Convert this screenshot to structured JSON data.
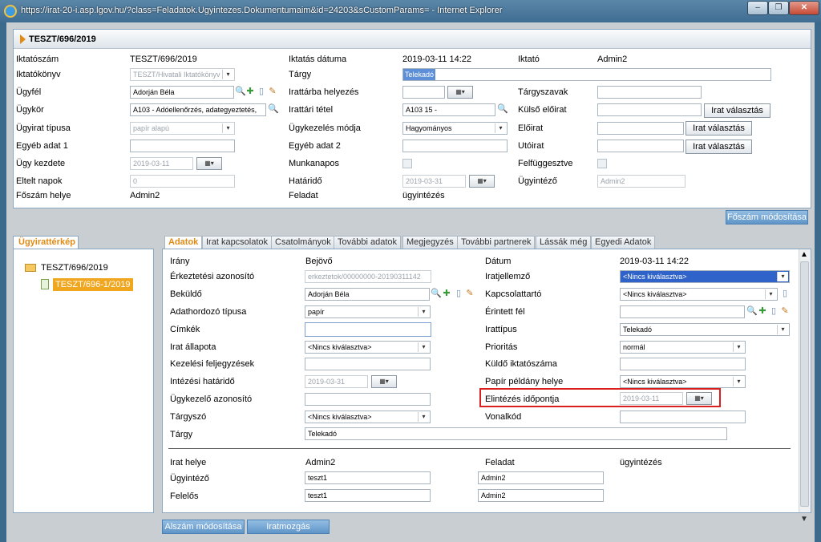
{
  "window": {
    "title": "https://irat-20-i.asp.lgov.hu/?class=Feladatok.Ugyintezes.Dokumentumaim&id=24203&sCustomParams= - Internet Explorer",
    "min": "–",
    "max": "❐",
    "close": "✕"
  },
  "head": {
    "title": "TESZT/696/2019",
    "iktatoszam_l": "Iktatószám",
    "iktatoszam_v": "TESZT/696/2019",
    "iktatokonyv_l": "Iktatókönyv",
    "iktatokonyv_v": "TESZT/Hivatali Iktatókönyv",
    "ugyfel_l": "Ügyfél",
    "ugyfel_v": "Adorján Béla",
    "ugykor_l": "Ügykör",
    "ugykor_v": "A103 - Adóellenőrzés, adategyeztetés,",
    "ugyirat_tipusa_l": "Ügyirat típusa",
    "ugyirat_tipusa_v": "papír alapú",
    "egyeb1_l": "Egyéb adat 1",
    "ugy_kezdete_l": "Ügy kezdete",
    "ugy_kezdete_v": "2019-03-11",
    "eltelt_l": "Eltelt napok",
    "eltelt_v": "0",
    "foszam_helye_l": "Főszám helye",
    "foszam_helye_v": "Admin2",
    "iktatas_datuma_l": "Iktatás dátuma",
    "iktatas_datuma_v": "2019-03-11 14:22",
    "targy_l": "Tárgy",
    "targy_v": "Telekadó",
    "irattarba_l": "Irattárba helyezés",
    "irattari_tetel_l": "Irattári tétel",
    "irattari_tetel_v": "A103 15 -",
    "ugykezeles_l": "Ügykezelés módja",
    "ugykezeles_v": "Hagyományos",
    "egyeb2_l": "Egyéb adat 2",
    "munkanapos_l": "Munkanapos",
    "hatarido_l": "Határidő",
    "hatarido_v": "2019-03-31",
    "feladat_l": "Feladat",
    "feladat_v": "ügyintézés",
    "iktato_l": "Iktató",
    "iktato_v": "Admin2",
    "targyszavak_l": "Tárgyszavak",
    "kulso_eloirat_l": "Külső előirat",
    "eloirat_l": "Előirat",
    "utoirat_l": "Utóirat",
    "felfuggesztve_l": "Felfüggesztve",
    "ugyintezo_l": "Ügyintéző",
    "ugyintezo_v": "Admin2",
    "irat_valasztas": "Irat választás",
    "foszam_modositasa": "Főszám módosítása"
  },
  "left": {
    "tab": "Ügyirattérkép",
    "folder": "TESZT/696/2019",
    "doc": "TESZT/696-1/2019"
  },
  "tabs": [
    "Adatok",
    "Irat kapcsolatok",
    "Csatolmányok",
    "További adatok",
    "Megjegyzés",
    "További partnerek",
    "Lássák még",
    "Egyedi Adatok"
  ],
  "form": {
    "irany_l": "Irány",
    "irany_v": "Bejövő",
    "erkeztetesi_l": "Érkeztetési azonosító",
    "erkeztetesi_v": "erkeztetok/00000000-20190311142",
    "bekuldo_l": "Beküldő",
    "bekuldo_v": "Adorján Béla",
    "adathordozo_l": "Adathordozó típusa",
    "adathordozo_v": "papír",
    "cimkek_l": "Címkék",
    "irat_allapota_l": "Irat állapota",
    "irat_allapota_v": "<Nincs kiválasztva>",
    "kezelesi_l": "Kezelési feljegyzések",
    "intezesi_l": "Intézési határidő",
    "intezesi_v": "2019-03-31",
    "ugykezelo_l": "Ügykezelő azonosító",
    "targyszo_l": "Tárgyszó",
    "targyszo_v": "<Nincs kiválasztva>",
    "targy_l": "Tárgy",
    "targy_v": "Telekadó",
    "datum_l": "Dátum",
    "datum_v": "2019-03-11 14:22",
    "iratjellemzo_l": "Iratjellemző",
    "iratjellemzo_v": "<Nincs kiválasztva>",
    "kapcsolattarto_l": "Kapcsolattartó",
    "kapcsolattarto_v": "<Nincs kiválasztva>",
    "erintett_l": "Érintett fél",
    "irattipus_l": "Irattípus",
    "irattipus_v": "Telekadó",
    "prioritas_l": "Prioritás",
    "prioritas_v": "normál",
    "kuldo_l": "Küldő iktatószáma",
    "papir_l": "Papír példány helye",
    "papir_v": "<Nincs kiválasztva>",
    "elintezes_l": "Elintézés időpontja",
    "elintezes_v": "2019-03-11",
    "vonalkod_l": "Vonalkód",
    "irat_helye_l": "Irat helye",
    "irat_helye_v": "Admin2",
    "feladat_l": "Feladat",
    "feladat_v": "ügyintézés",
    "ugyintezo_l": "Ügyintéző",
    "ugyintezo_v": "teszt1",
    "ugyintezo_v2": "Admin2",
    "felelos_l": "Felelős",
    "felelos_v": "teszt1",
    "felelos_v2": "Admin2"
  },
  "buttons": {
    "alszam": "Alszám módosítása",
    "iratmozgas": "Iratmozgás"
  },
  "icons": {
    "magnifier": "magnifier-icon",
    "cal": "▦▾",
    "arrow": "▾"
  }
}
